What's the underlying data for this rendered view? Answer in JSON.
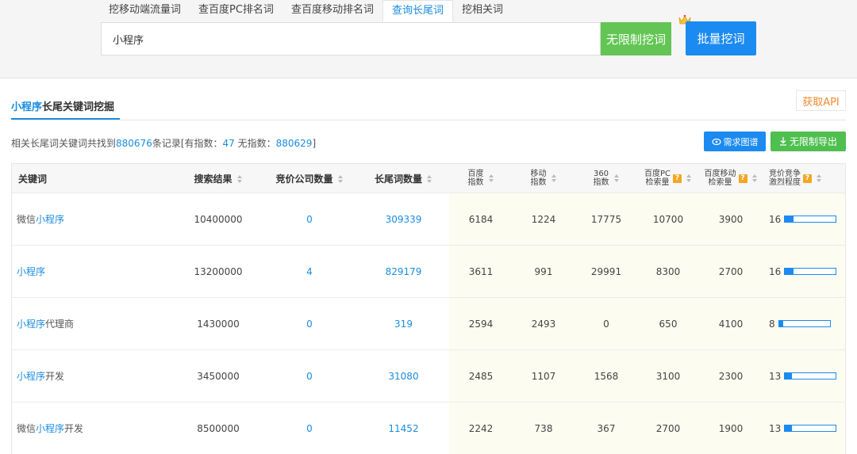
{
  "tabs": [
    {
      "label": "挖移动端流量词",
      "active": false
    },
    {
      "label": "查百度PC排名词",
      "active": false
    },
    {
      "label": "查百度移动排名词",
      "active": false
    },
    {
      "label": "查询长尾词",
      "active": true
    },
    {
      "label": "挖相关词",
      "active": false
    }
  ],
  "search": {
    "value": "小程序"
  },
  "buttons": {
    "unlimited": "无限制挖词",
    "batch": "批量挖词",
    "api": "获取API",
    "graph": "需求图谱",
    "export": "无限制导出"
  },
  "section": {
    "title_highlight": "小程序",
    "title_rest": "长尾关键词挖掘"
  },
  "summary": {
    "prefix": "相关长尾词关键词共找到",
    "total": "880676",
    "mid1": "条记录[有指数：",
    "with_index": "47",
    "mid2": " 无指数：",
    "without_index": "880629",
    "suffix": "]"
  },
  "columns": {
    "keyword": "关键词",
    "results": "搜索结果",
    "bidders": "竞价公司数量",
    "longtail": "长尾词数量",
    "baidu_index_1": "百度",
    "baidu_index_2": "指数",
    "mobile_index_1": "移动",
    "mobile_index_2": "指数",
    "i360_1": "360",
    "i360_2": "指数",
    "pc_volume_1": "百度PC",
    "pc_volume_2": "检索量",
    "mobile_volume_1": "百度移动",
    "mobile_volume_2": "检索量",
    "competition_1": "竞价竞争",
    "competition_2": "激烈程度"
  },
  "rows": [
    {
      "kw_pre": "微信",
      "kw_hl": "小程序",
      "kw_post": "",
      "results": "10400000",
      "bidders": "0",
      "longtail": "309339",
      "baidu": "6184",
      "mobile": "1224",
      "i360": "17775",
      "pc": "10700",
      "mvol": "3900",
      "comp": "16",
      "comp_level": 0.16
    },
    {
      "kw_pre": "",
      "kw_hl": "小程序",
      "kw_post": "",
      "results": "13200000",
      "bidders": "4",
      "longtail": "829179",
      "baidu": "3611",
      "mobile": "991",
      "i360": "29991",
      "pc": "8300",
      "mvol": "2700",
      "comp": "16",
      "comp_level": 0.16
    },
    {
      "kw_pre": "",
      "kw_hl": "小程序",
      "kw_post": "代理商",
      "results": "1430000",
      "bidders": "0",
      "longtail": "319",
      "baidu": "2594",
      "mobile": "2493",
      "i360": "0",
      "pc": "650",
      "mvol": "4100",
      "comp": "8",
      "comp_level": 0.08
    },
    {
      "kw_pre": "",
      "kw_hl": "小程序",
      "kw_post": "开发",
      "results": "3450000",
      "bidders": "0",
      "longtail": "31080",
      "baidu": "2485",
      "mobile": "1107",
      "i360": "1568",
      "pc": "3100",
      "mvol": "2300",
      "comp": "13",
      "comp_level": 0.13
    },
    {
      "kw_pre": "微信",
      "kw_hl": "小程序",
      "kw_post": "开发",
      "results": "8500000",
      "bidders": "0",
      "longtail": "11452",
      "baidu": "2242",
      "mobile": "738",
      "i360": "367",
      "pc": "2700",
      "mvol": "1900",
      "comp": "13",
      "comp_level": 0.13
    }
  ],
  "colors": {
    "accent": "#1a8ce0",
    "green": "#63c554",
    "orange": "#f08a2e",
    "warning": "#f5a623"
  },
  "icons": [
    "crown-icon",
    "sort-icon",
    "help-icon",
    "graph-icon",
    "download-icon"
  ]
}
